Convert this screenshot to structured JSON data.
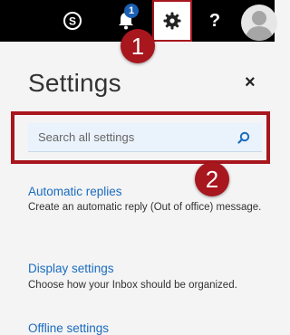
{
  "topbar": {
    "icons": [
      "skype-icon",
      "bell-icon",
      "gear-icon",
      "help-icon",
      "avatar"
    ],
    "notification_count": "1",
    "help_label": "?"
  },
  "markers": {
    "one": "1",
    "two": "2"
  },
  "settings": {
    "title": "Settings",
    "close_label": "×",
    "search": {
      "placeholder": "Search all settings"
    },
    "items": [
      {
        "title": "Automatic replies",
        "description": "Create an automatic reply (Out of office) message."
      },
      {
        "title": "Display settings",
        "description": "Choose how your Inbox should be organized."
      },
      {
        "title": "Offline settings",
        "description": ""
      }
    ]
  },
  "colors": {
    "topbar": "#000000",
    "accent_blue": "#1a6cbf",
    "callout_red": "#a8161e",
    "panel_bg": "#f4f4f4",
    "search_bg": "#eaf2fb"
  }
}
